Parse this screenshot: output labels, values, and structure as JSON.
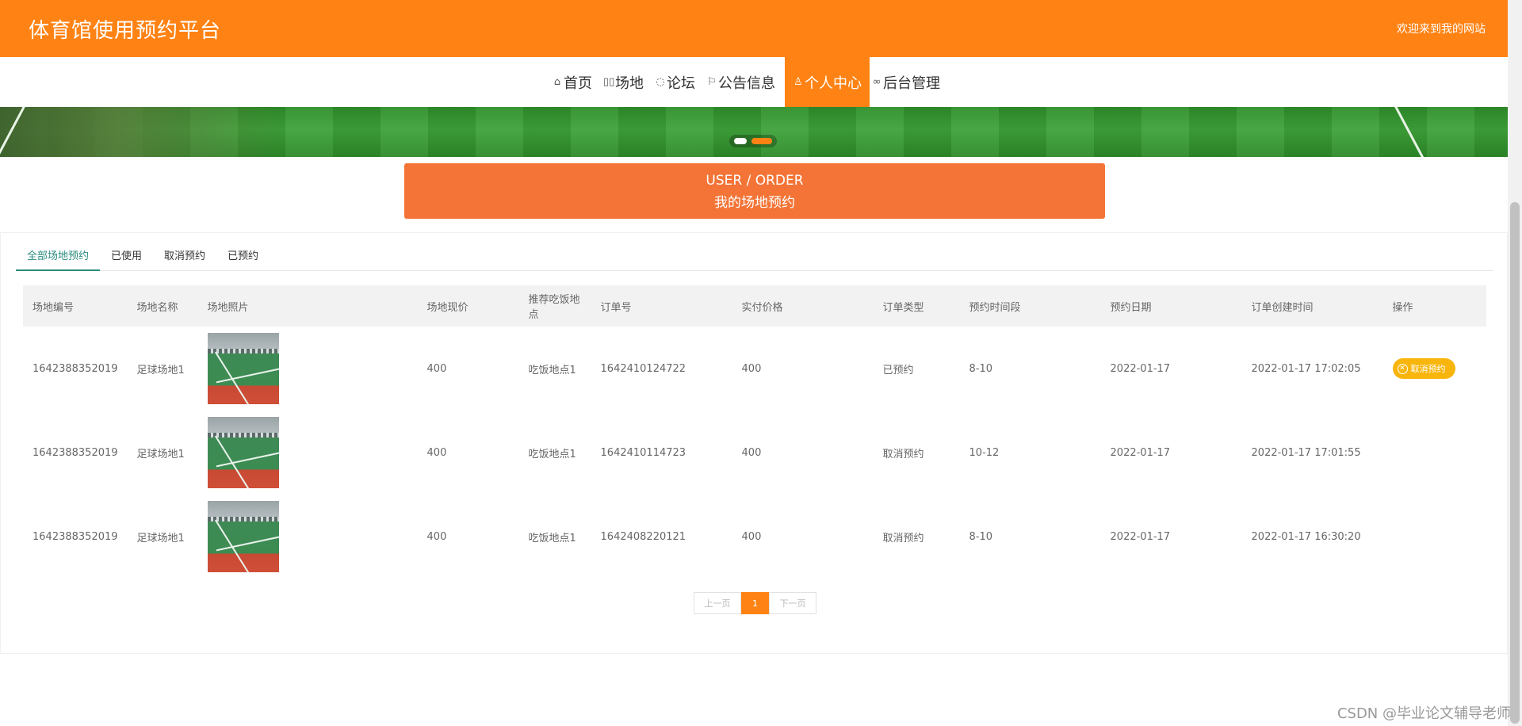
{
  "header": {
    "title": "体育馆使用预约平台",
    "welcome": "欢迎来到我的网站"
  },
  "nav": {
    "items": [
      {
        "label": "首页",
        "icon": "home-icon"
      },
      {
        "label": "场地",
        "icon": "venue-icon"
      },
      {
        "label": "论坛",
        "icon": "forum-icon"
      },
      {
        "label": "公告信息",
        "icon": "flag-icon"
      },
      {
        "label": "个人中心",
        "icon": "user-icon",
        "active": true
      },
      {
        "label": "后台管理",
        "icon": "link-icon"
      }
    ]
  },
  "section": {
    "title_en": "USER / ORDER",
    "title_cn": "我的场地预约"
  },
  "tabs": [
    {
      "label": "全部场地预约",
      "active": true
    },
    {
      "label": "已使用"
    },
    {
      "label": "取消预约"
    },
    {
      "label": "已预约"
    }
  ],
  "table": {
    "headers": [
      "场地编号",
      "场地名称",
      "场地照片",
      "场地现价",
      "推荐吃饭地点",
      "订单号",
      "实付价格",
      "订单类型",
      "预约时间段",
      "预约日期",
      "订单创建时间",
      "操作"
    ],
    "rows": [
      {
        "venue_id": "1642388352019",
        "venue_name": "足球场地1",
        "price": "400",
        "dining": "吃饭地点1",
        "order_no": "1642410124722",
        "paid": "400",
        "type": "已预约",
        "slot": "8-10",
        "date": "2022-01-17",
        "created": "2022-01-17 17:02:05",
        "action": "取消预约"
      },
      {
        "venue_id": "1642388352019",
        "venue_name": "足球场地1",
        "price": "400",
        "dining": "吃饭地点1",
        "order_no": "1642410114723",
        "paid": "400",
        "type": "取消预约",
        "slot": "10-12",
        "date": "2022-01-17",
        "created": "2022-01-17 17:01:55",
        "action": ""
      },
      {
        "venue_id": "1642388352019",
        "venue_name": "足球场地1",
        "price": "400",
        "dining": "吃饭地点1",
        "order_no": "1642408220121",
        "paid": "400",
        "type": "取消预约",
        "slot": "8-10",
        "date": "2022-01-17",
        "created": "2022-01-17 16:30:20",
        "action": ""
      }
    ]
  },
  "pager": {
    "prev": "上一页",
    "current": "1",
    "next": "下一页"
  },
  "watermark": "CSDN @毕业论文辅导老师",
  "colors": {
    "brand": "#ff8314",
    "title_box": "#f37436",
    "tab_active": "#2a8c7e",
    "price": "#e0231e",
    "cancel_button": "#f8b50c"
  }
}
